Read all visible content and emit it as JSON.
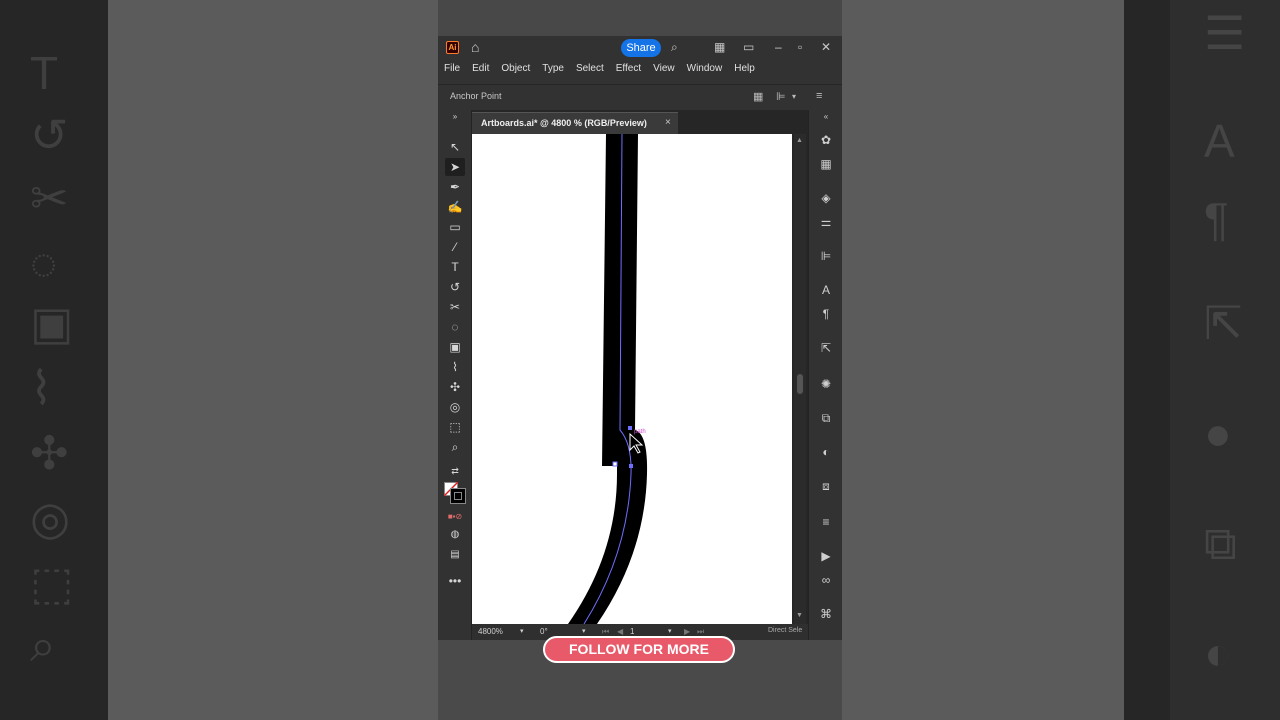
{
  "titlebar": {
    "logo": "Ai",
    "share_label": "Share",
    "icons": [
      "home-icon",
      "search-icon",
      "arrange-documents-icon",
      "panel-icon",
      "minimize-icon",
      "maximize-icon",
      "close-icon"
    ]
  },
  "menubar": {
    "items": [
      "File",
      "Edit",
      "Object",
      "Type",
      "Select",
      "Effect",
      "View",
      "Window",
      "Help"
    ]
  },
  "control_bar": {
    "label": "Anchor Point"
  },
  "document": {
    "tab_title": "Artboards.ai* @ 4800 % (RGB/Preview)",
    "tab_close": "×"
  },
  "status": {
    "zoom": "4800%",
    "rotation": "0°",
    "artboard": "1",
    "tool": "Direct Sele"
  },
  "canvas": {
    "hover_label": "path",
    "stroke_color": "#000000",
    "path_color": "#6f6fff"
  },
  "overlay": {
    "cta": "FOLLOW FOR MORE"
  },
  "colors": {
    "accent": "#1473e6",
    "cta": "#e85a6a"
  }
}
